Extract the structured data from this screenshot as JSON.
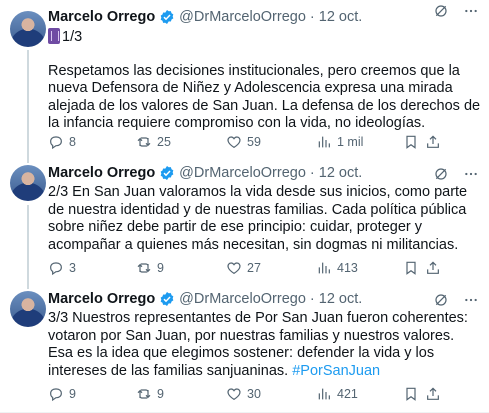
{
  "tweets": [
    {
      "author_name": "Marcelo Orrego",
      "handle": "@DrMarceloOrrego",
      "separator": "·",
      "date": "12 oct.",
      "lead": "1/3",
      "paragraph": "Respetamos las decisiones institucionales, pero creemos que la nueva Defensora de Niñez y Adolescencia expresa una mirada alejada de los valores de San Juan. La defensa de los derechos de la infancia requiere compromiso con la vida, no ideologías.",
      "replies": "8",
      "retweets": "25",
      "likes": "59",
      "views": "1 mil"
    },
    {
      "author_name": "Marcelo Orrego",
      "handle": "@DrMarceloOrrego",
      "separator": "·",
      "date": "12 oct.",
      "paragraph": "2/3 En San Juan valoramos la vida desde sus inicios, como parte de nuestra identidad y de nuestras familias. Cada política pública sobre niñez debe partir de ese principio: cuidar, proteger y acompañar a quienes más necesitan, sin dogmas ni militancias.",
      "replies": "3",
      "retweets": "9",
      "likes": "27",
      "views": "413"
    },
    {
      "author_name": "Marcelo Orrego",
      "handle": "@DrMarceloOrrego",
      "separator": "·",
      "date": "12 oct.",
      "paragraph": "3/3 Nuestros representantes de Por San Juan fueron coherentes: votaron por San Juan, por nuestras familias y nuestros valores. Esa es la idea que elegimos sostener: defender la vida y los intereses de las familias sanjuaninas.",
      "hashtag": "#PorSanJuan",
      "replies": "9",
      "retweets": "9",
      "likes": "30",
      "views": "421"
    }
  ],
  "icons": {
    "verified": "verified-badge-icon",
    "grok": "grok-icon",
    "more": "more-icon",
    "reply": "reply-icon",
    "retweet": "retweet-icon",
    "like": "heart-icon",
    "views": "views-icon",
    "bookmark": "bookmark-icon",
    "share": "share-icon",
    "thread_emoji": "purple-box-emoji-icon"
  },
  "colors": {
    "text": "#0f1419",
    "secondary": "#536471",
    "verified": "#1d9bf0",
    "link": "#1d9bf0",
    "thread_line": "#cfd9de"
  }
}
